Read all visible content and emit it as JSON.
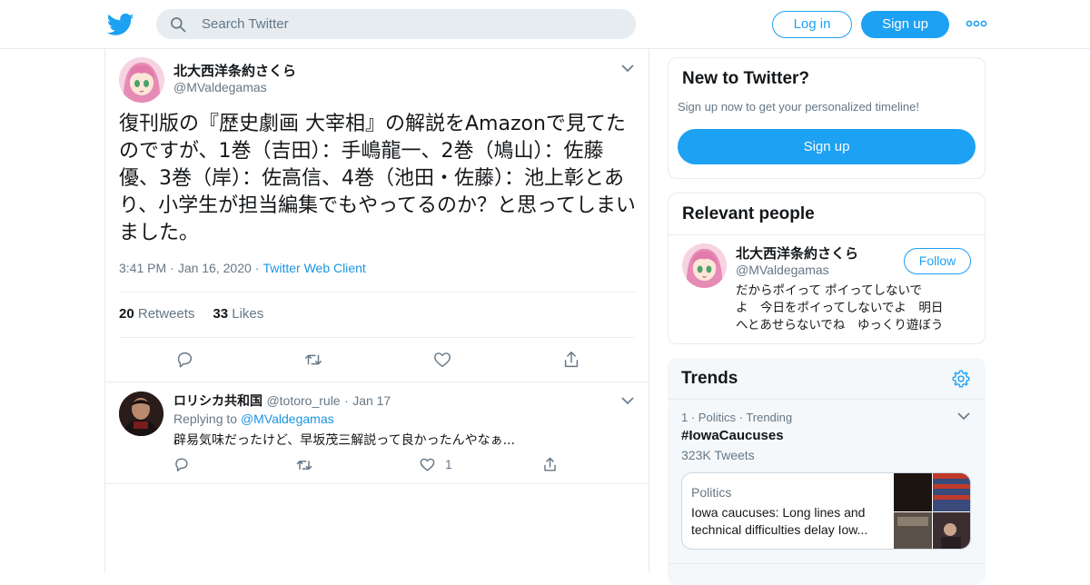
{
  "header": {
    "search_placeholder": "Search Twitter",
    "login_label": "Log in",
    "signup_label": "Sign up",
    "brand_color": "#1da1f2"
  },
  "tweet": {
    "author_name": "北大西洋条約さくら",
    "author_handle": "@MValdegamas",
    "text": "復刊版の『歴史劇画 大宰相』の解説をAmazonで見てたのですが、1巻（吉田）：手嶋龍一、2巻（鳩山）：佐藤優、3巻（岸）：佐高信、4巻（池田・佐藤）：池上彰とあり、小学生が担当編集でもやってるのか？と思ってしまいました。",
    "time": "3:41 PM",
    "date": "Jan 16, 2020",
    "client": "Twitter Web Client",
    "retweets_count": "20",
    "retweets_label": "Retweets",
    "likes_count": "33",
    "likes_label": "Likes",
    "icons": [
      "reply-icon",
      "retweet-icon",
      "like-icon",
      "share-icon"
    ]
  },
  "reply": {
    "author_name": "ロリシカ共和国",
    "author_handle": "@totoro_rule",
    "date": "Jan 17",
    "replying_prefix": "Replying to",
    "replying_to": "@MValdegamas",
    "text": "辟易気味だったけど、早坂茂三解説って良かったんやなぁ...",
    "likes_count": "1"
  },
  "sidebar": {
    "new_to_twitter": {
      "title": "New to Twitter?",
      "subtitle": "Sign up now to get your personalized timeline!",
      "button_label": "Sign up"
    },
    "relevant_people": {
      "title": "Relevant people",
      "name": "北大西洋条約さくら",
      "handle": "@MValdegamas",
      "follow_label": "Follow",
      "bio": "だからポイって ポイってしないで\nよ　今日をポイってしないでよ　明日\nへとあせらないでね　ゆっくり遊ぼう"
    },
    "trends": {
      "title": "Trends",
      "rank": "1",
      "category": "Politics",
      "status": "Trending",
      "hashtag": "#IowaCaucuses",
      "tweet_count": "323K Tweets",
      "news_category": "Politics",
      "news_headline": "Iowa caucuses: Long lines and technical difficulties delay Iow..."
    }
  }
}
